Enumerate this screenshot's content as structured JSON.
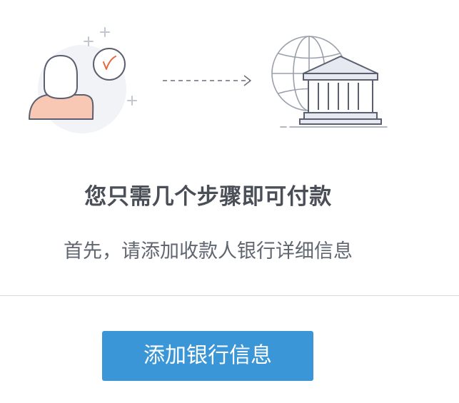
{
  "illustration": {
    "payer_icon": "person-with-clock-icon",
    "arrow_icon": "dashed-arrow-right-icon",
    "bank_icon": "bank-with-globe-icon",
    "colors": {
      "outline": "#5b6070",
      "skin": "#f9c8b4",
      "check": "#e86a3a",
      "bubble": "#f1f3f6",
      "sparkle": "#c2c6ce",
      "bank_roof": "#e6e9ef",
      "globe_line": "#9aa0ab"
    }
  },
  "headline": "您只需几个步骤即可付款",
  "subtext": "首先，请添加收款人银行详细信息",
  "primary_button": {
    "label": "添加银行信息",
    "color": "#3a96d6"
  }
}
